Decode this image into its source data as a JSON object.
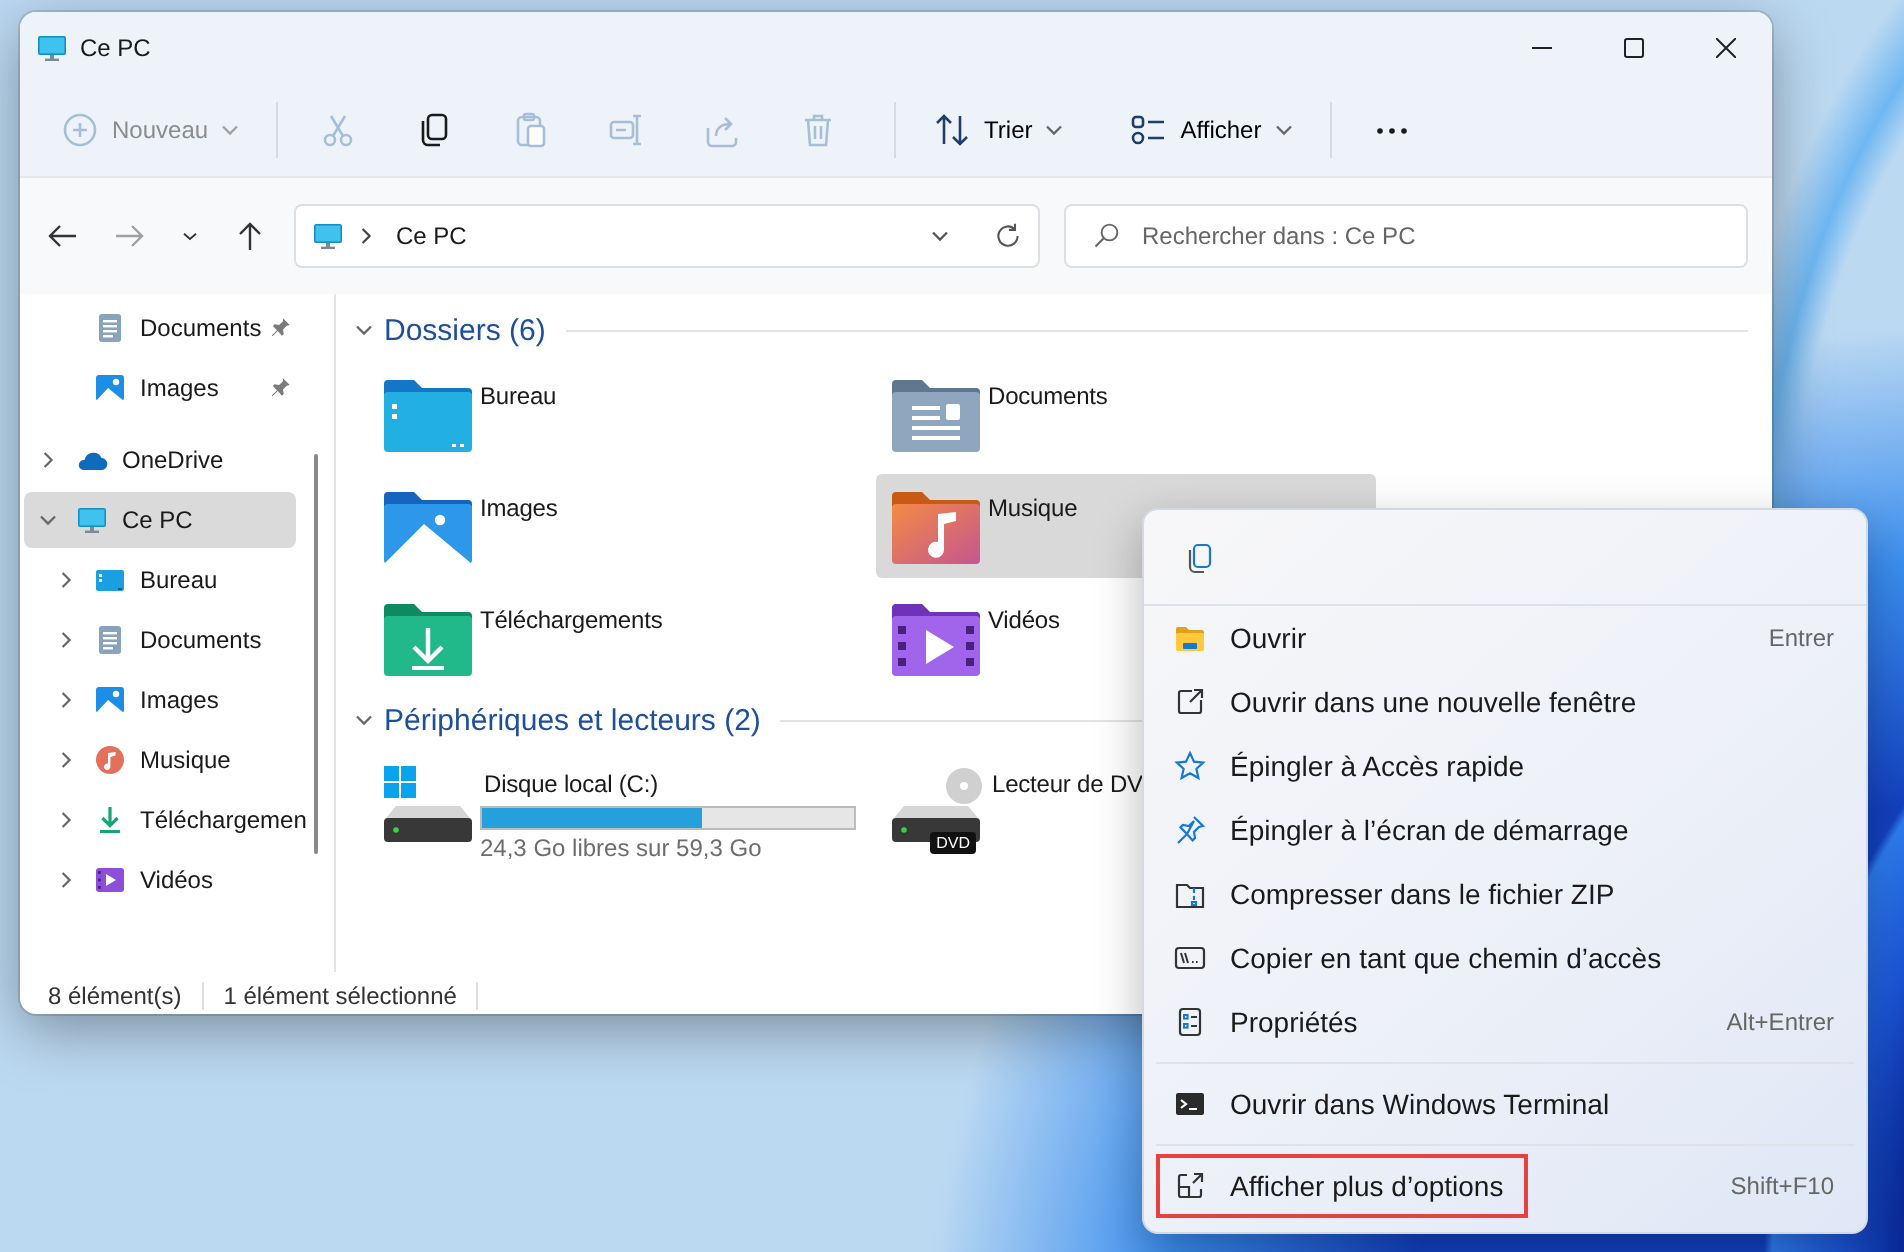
{
  "window": {
    "title": "Ce PC"
  },
  "toolbar": {
    "items": [
      {
        "kind": "new",
        "label": "Nouveau",
        "disabled": true
      },
      {
        "kind": "cut",
        "disabled": true
      },
      {
        "kind": "copy",
        "disabled": false
      },
      {
        "kind": "paste",
        "disabled": true
      },
      {
        "kind": "rename",
        "disabled": true
      },
      {
        "kind": "share",
        "disabled": true
      },
      {
        "kind": "delete",
        "disabled": true
      },
      {
        "kind": "sort",
        "label": "Trier",
        "disabled": false
      },
      {
        "kind": "view",
        "label": "Afficher",
        "disabled": false
      },
      {
        "kind": "more",
        "disabled": false
      }
    ]
  },
  "navigation": [
    {
      "kind": "back",
      "disabled": false
    },
    {
      "kind": "forward",
      "disabled": true
    },
    {
      "kind": "recent",
      "disabled": false
    },
    {
      "kind": "up",
      "disabled": false
    }
  ],
  "address_bar": {
    "location": "Ce PC"
  },
  "search": {
    "placeholder": "Rechercher dans : Ce PC"
  },
  "sidebar": {
    "pinned": [
      {
        "label": "Documents",
        "kind": "documents",
        "pinned": true
      },
      {
        "label": "Images",
        "kind": "pictures",
        "pinned": true
      }
    ],
    "tree": [
      {
        "label": "OneDrive",
        "kind": "cloud",
        "expanded": false,
        "selected": false
      },
      {
        "label": "Ce PC",
        "kind": "pc",
        "expanded": true,
        "selected": true,
        "children": [
          {
            "label": "Bureau",
            "kind": "desktop",
            "expanded": false,
            "selected": false
          },
          {
            "label": "Documents",
            "kind": "documents",
            "expanded": false,
            "selected": false
          },
          {
            "label": "Images",
            "kind": "pictures",
            "expanded": false,
            "selected": false
          },
          {
            "label": "Musique",
            "kind": "music",
            "expanded": false,
            "selected": false
          },
          {
            "label": "Téléchargemen",
            "kind": "downloads",
            "expanded": false,
            "selected": false
          },
          {
            "label": "Vidéos",
            "kind": "videos",
            "expanded": false,
            "selected": false
          }
        ]
      }
    ]
  },
  "content": {
    "sections": [
      {
        "title": "Dossiers (6)",
        "kind": "folders",
        "expanded": true,
        "items": [
          {
            "label": "Bureau",
            "kind": "desktop",
            "selected": false
          },
          {
            "label": "Documents",
            "kind": "documents",
            "selected": false
          },
          {
            "label": "Images",
            "kind": "pictures",
            "selected": false
          },
          {
            "label": "Musique",
            "kind": "music",
            "selected": true
          },
          {
            "label": "Téléchargements",
            "kind": "downloads",
            "selected": false
          },
          {
            "label": "Vidéos",
            "kind": "videos",
            "selected": false
          }
        ]
      },
      {
        "title": "Périphériques et lecteurs (2)",
        "kind": "drives",
        "expanded": true,
        "items": [
          {
            "label": "Disque local (C:)",
            "kind": "system",
            "selected": false,
            "level": 0.59,
            "detail": "24,3 Go libres sur 59,3 Go"
          },
          {
            "label": "Lecteur de DV",
            "kind": "dvd",
            "selected": false,
            "badge": "DVD"
          }
        ]
      }
    ]
  },
  "status_bar": {
    "count": "8 élément(s)",
    "selection": "1 élément sélectionné"
  },
  "context_menu": {
    "quick_actions": [
      {
        "kind": "copy"
      }
    ],
    "groups": [
      [
        {
          "kind": "open",
          "label": "Ouvrir",
          "shortcut": "Entrer",
          "highlighted": false
        },
        {
          "kind": "new_window",
          "label": "Ouvrir dans une nouvelle fenêtre",
          "highlighted": false
        },
        {
          "kind": "star",
          "label": "Épingler à Accès rapide",
          "highlighted": false
        },
        {
          "kind": "pin",
          "label": "Épingler à l’écran de démarrage",
          "highlighted": false
        },
        {
          "kind": "zip",
          "label": "Compresser dans le fichier ZIP",
          "highlighted": false
        },
        {
          "kind": "path",
          "label": "Copier en tant que chemin d’accès",
          "highlighted": false
        },
        {
          "kind": "properties",
          "label": "Propriétés",
          "shortcut": "Alt+Entrer",
          "highlighted": false
        }
      ],
      [
        {
          "kind": "terminal",
          "label": "Ouvrir dans Windows Terminal",
          "highlighted": false
        }
      ],
      [
        {
          "kind": "more_options",
          "label": "Afficher plus d’options",
          "shortcut": "Shift+F10",
          "highlighted": true
        }
      ]
    ]
  }
}
